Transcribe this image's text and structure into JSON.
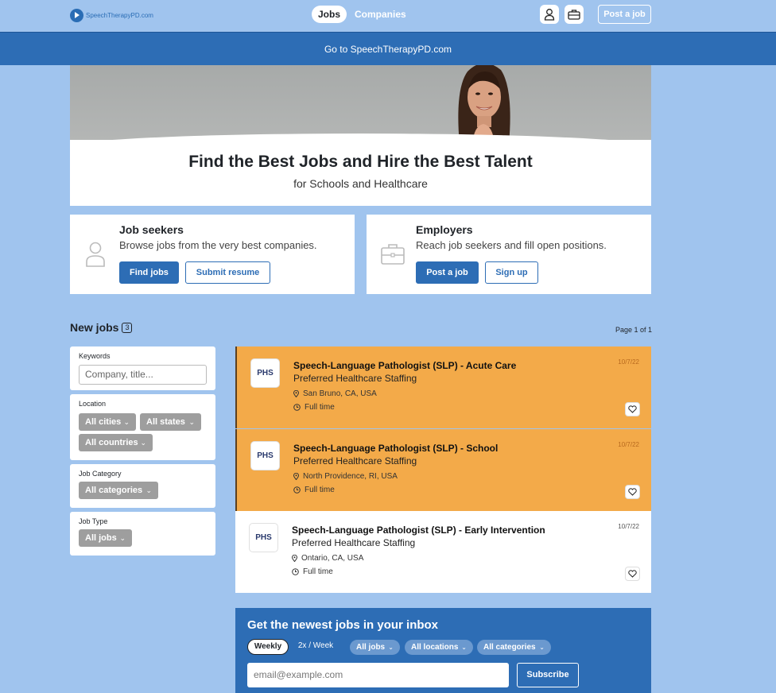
{
  "nav": {
    "logo_text": "SpeechTherapyPD.com",
    "tabs": [
      {
        "label": "Jobs",
        "active": true
      },
      {
        "label": "Companies",
        "active": false
      }
    ],
    "post_job_label": "Post a job"
  },
  "banner": {
    "text": "Go to SpeechTherapyPD.com"
  },
  "hero": {
    "title": "Find the Best Jobs and Hire the Best Talent",
    "subtitle": "for Schools and Healthcare"
  },
  "seekers": {
    "title": "Job seekers",
    "desc": "Browse jobs from the very best companies.",
    "primary": "Find jobs",
    "secondary": "Submit resume"
  },
  "employers": {
    "title": "Employers",
    "desc": "Reach job seekers and fill open positions.",
    "primary": "Post a job",
    "secondary": "Sign up"
  },
  "listing": {
    "heading": "New jobs",
    "count": "3",
    "page_info": "Page 1 of 1"
  },
  "filters": {
    "keywords_label": "Keywords",
    "keywords_placeholder": "Company, title...",
    "location_label": "Location",
    "cities": "All cities",
    "states": "All states",
    "countries": "All countries",
    "category_label": "Job Category",
    "categories": "All categories",
    "type_label": "Job Type",
    "types": "All jobs"
  },
  "jobs": [
    {
      "logo": "PHS",
      "title": "Speech-Language Pathologist (SLP) - Acute Care",
      "company": "Preferred Healthcare Staffing",
      "location": "San Bruno, CA, USA",
      "type": "Full time",
      "date": "10/7/22",
      "featured": true
    },
    {
      "logo": "PHS",
      "title": "Speech-Language Pathologist (SLP) - School",
      "company": "Preferred Healthcare Staffing",
      "location": "North Providence, RI, USA",
      "type": "Full time",
      "date": "10/7/22",
      "featured": true
    },
    {
      "logo": "PHS",
      "title": "Speech-Language Pathologist (SLP) - Early Intervention",
      "company": "Preferred Healthcare Staffing",
      "location": "Ontario, CA, USA",
      "type": "Full time",
      "date": "10/7/22",
      "featured": false
    }
  ],
  "subscribe": {
    "title": "Get the newest jobs in your inbox",
    "freq_weekly": "Weekly",
    "freq_twice": "2x / Week",
    "jobs_filter": "All jobs",
    "locations_filter": "All locations",
    "categories_filter": "All categories",
    "email_placeholder": "email@example.com",
    "button": "Subscribe"
  },
  "colors": {
    "background": "#a0c4ee",
    "brand": "#2d6db5",
    "featured": "#f3aa49"
  }
}
